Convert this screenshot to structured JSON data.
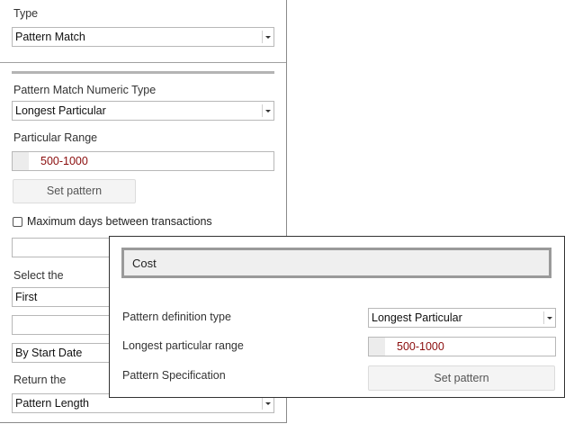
{
  "left": {
    "type_label": "Type",
    "type_value": "Pattern Match",
    "numeric_type_label": "Pattern Match Numeric Type",
    "numeric_type_value": "Longest Particular",
    "particular_range_label": "Particular Range",
    "particular_range_value": "500-1000",
    "set_pattern_label": "Set pattern",
    "max_days_label": "Maximum days between transactions",
    "max_days_checked": false,
    "max_days_value": "",
    "select_the_label": "Select the",
    "select_the_value": "First",
    "blank_field_value": "",
    "by_date_value": "By Start Date",
    "return_the_label": "Return the",
    "return_the_value": "Pattern Length"
  },
  "overlay": {
    "header_text": "Cost",
    "def_type_label": "Pattern definition type",
    "def_type_value": "Longest Particular",
    "range_label": "Longest particular range",
    "range_value": "500-1000",
    "spec_label": "Pattern Specification",
    "set_pattern_label": "Set pattern"
  },
  "colors": {
    "range_text": "#8b0d0d",
    "border": "#b8b8b8"
  },
  "icons": {
    "dropdown": "chevron-down-icon"
  }
}
